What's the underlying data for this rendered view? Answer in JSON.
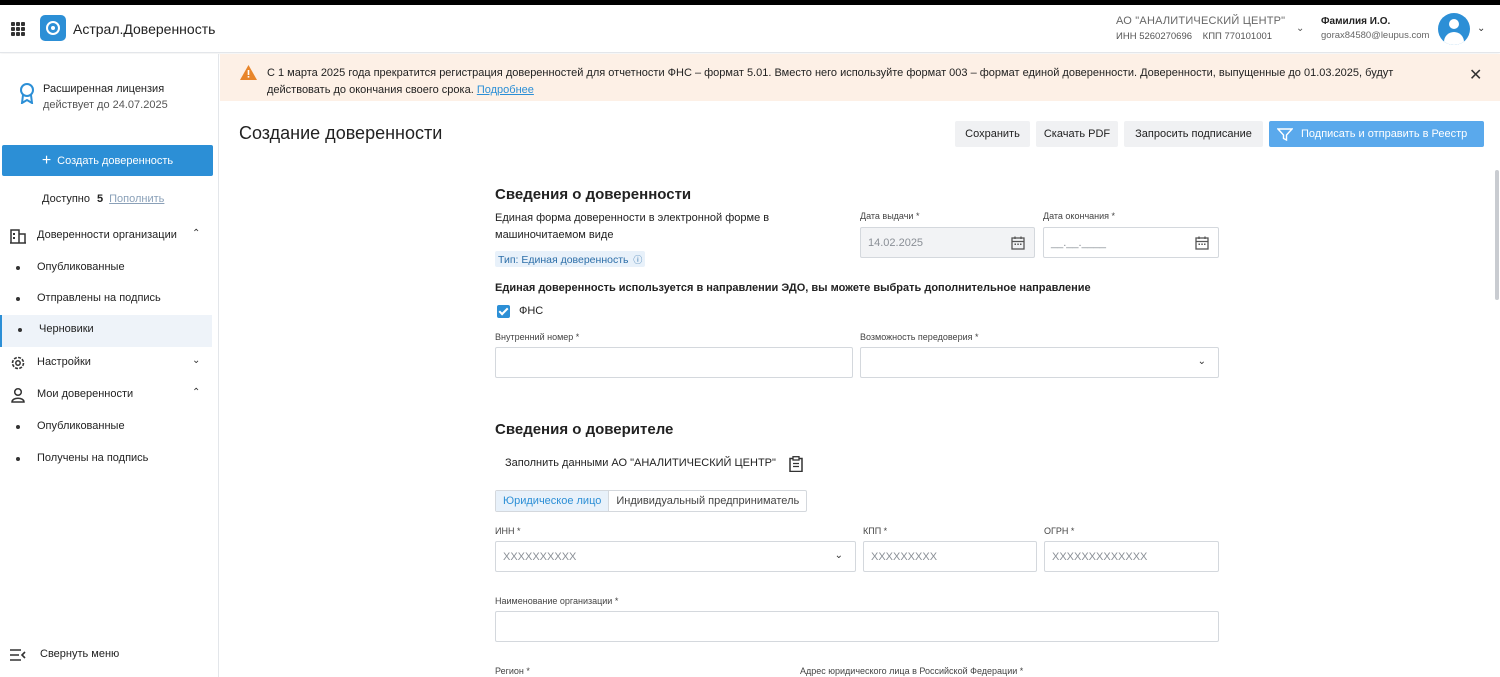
{
  "header": {
    "app_title": "Астрал.Доверенность",
    "org_name": "АО \"АНАЛИТИЧЕСКИЙ ЦЕНТР\"",
    "org_inn": "ИНН 5260270696",
    "org_kpp": "КПП 770101001",
    "user_name": "Фамилия И.О.",
    "user_email": "gorax84580@leupus.com"
  },
  "sidebar": {
    "license_title": "Расширенная лицензия",
    "license_valid": "действует до 24.07.2025",
    "create_button": "Создать доверенность",
    "available_label": "Доступно",
    "available_count": "5",
    "topup_link": "Пополнить",
    "org_group": "Доверенности организации",
    "org_items": [
      "Опубликованные",
      "Отправлены на подпись",
      "Черновики"
    ],
    "settings": "Настройки",
    "my_group": "Мои доверенности",
    "my_items": [
      "Опубликованные",
      "Получены на подпись"
    ],
    "collapse": "Свернуть меню"
  },
  "banner": {
    "text": "С 1 марта 2025 года прекратится регистрация доверенностей для отчетности ФНС – формат 5.01. Вместо него используйте формат 003 – формат единой доверенности. Доверенности, выпущенные до 01.03.2025, будут действовать до окончания своего срока. ",
    "link": "Подробнее"
  },
  "page": {
    "title": "Создание доверенности",
    "btn_save": "Сохранить",
    "btn_pdf": "Скачать PDF",
    "btn_request": "Запросить подписание",
    "btn_sign": "Подписать и отправить в Реестр"
  },
  "form": {
    "section1": "Сведения о доверенности",
    "form_desc": "Единая форма доверенности в электронной форме в машиночитаемом виде",
    "type_tag": "Тип: Единая доверенность",
    "issue_date_label": "Дата выдачи *",
    "issue_date": "14.02.2025",
    "end_date_label": "Дата окончания *",
    "end_date_placeholder": "__.__.____",
    "edo_text": "Единая доверенность используется в направлении ЭДО, вы можете выбрать дополнительное направление",
    "fns_label": "ФНС",
    "internal_number_label": "Внутренний номер *",
    "redelegation_label": "Возможность передоверия *",
    "section2": "Сведения о доверителе",
    "fill_with": "Заполнить данными АО \"АНАЛИТИЧЕСКИЙ ЦЕНТР\"",
    "seg_legal": "Юридическое лицо",
    "seg_ip": "Индивидуальный предприниматель",
    "inn_label": "ИНН *",
    "inn_value": "XXXXXXXXXX",
    "kpp_label": "КПП *",
    "kpp_value": "XXXXXXXXX",
    "ogrn_label": "ОГРН *",
    "ogrn_value": "XXXXXXXXXXXXX",
    "org_name_label": "Наименование организации *",
    "region_label": "Регион *",
    "address_label": "Адрес юридического лица в Российской Федерации *"
  },
  "colors": {
    "accent": "#2c8fd6",
    "banner_bg": "#fdf0e6",
    "warning": "#e8852a"
  }
}
